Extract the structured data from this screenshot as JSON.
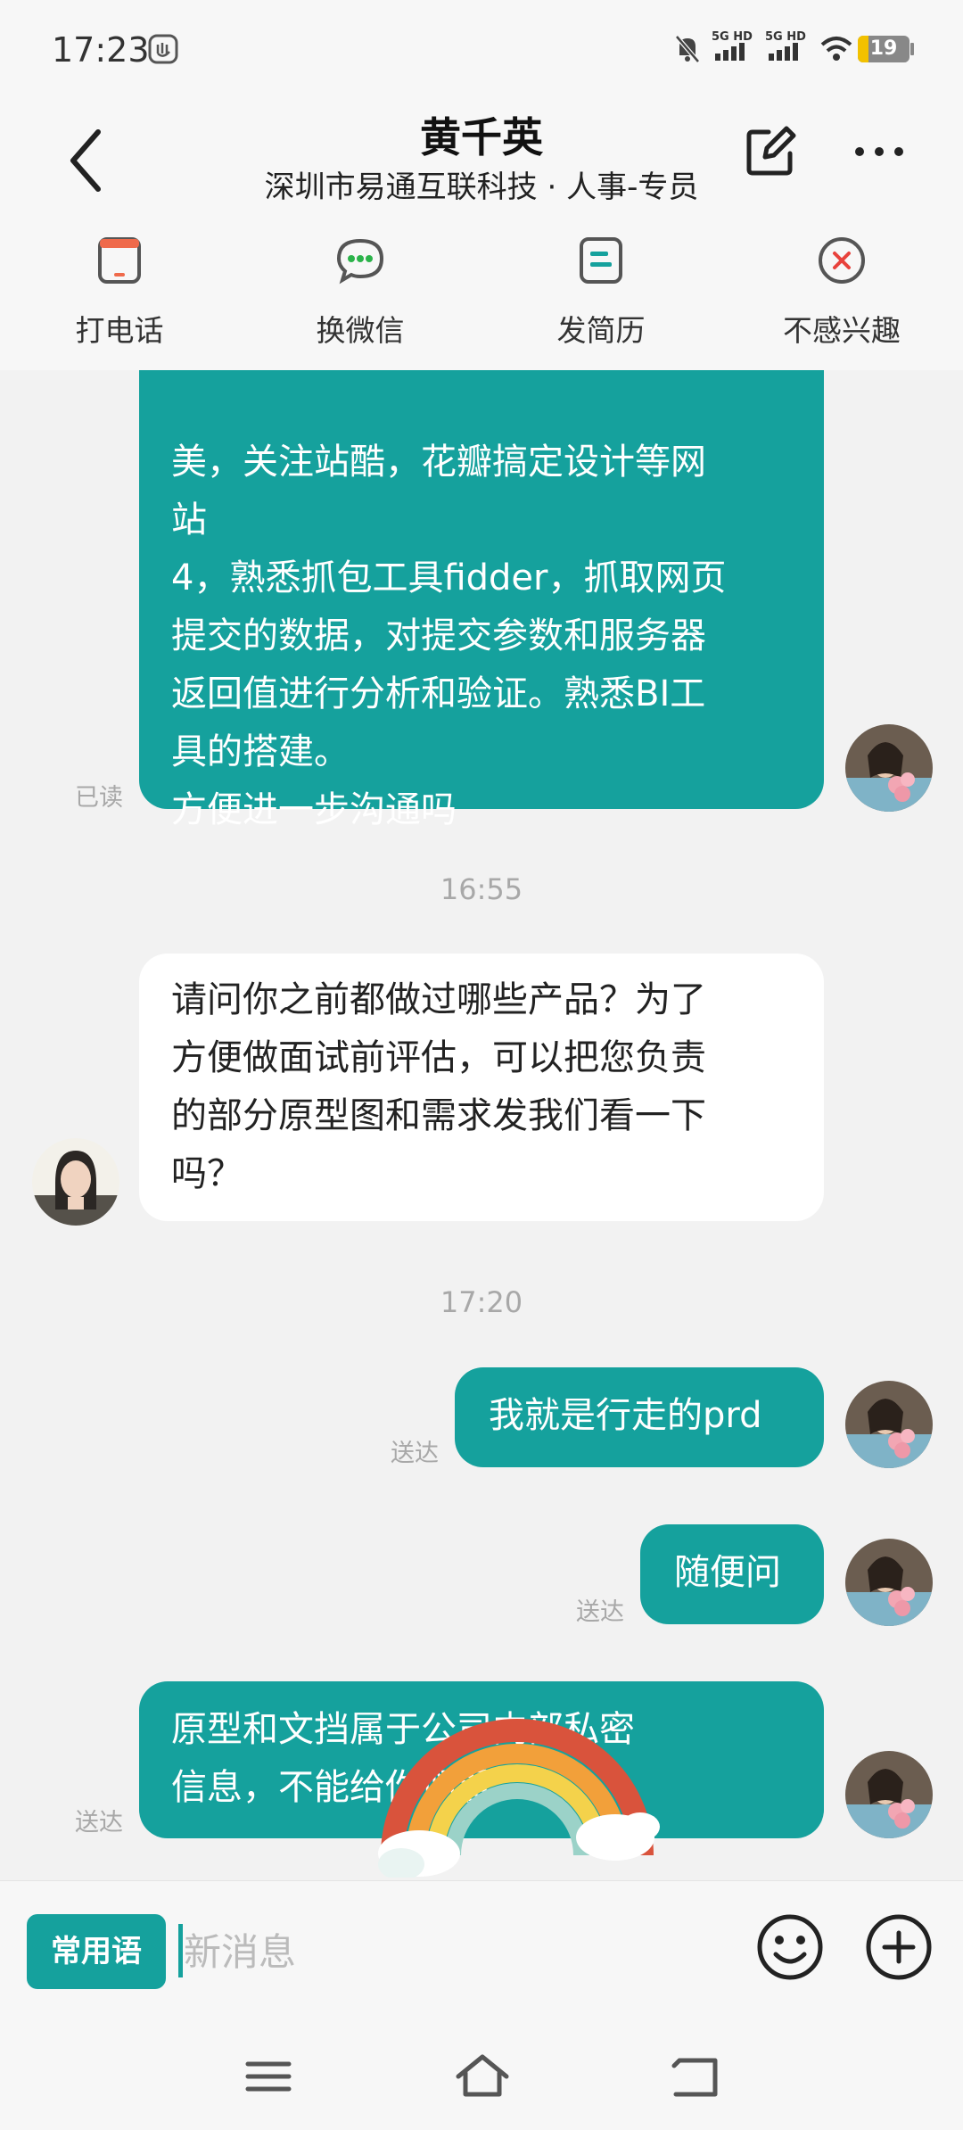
{
  "status_bar": {
    "time": "17:23",
    "network_1": "5G HD",
    "network_2": "5G HD",
    "battery": "19"
  },
  "header": {
    "name": "黄千英",
    "subtitle": "深圳市易通互联科技 · 人事-专员"
  },
  "actions": [
    {
      "label": "打电话",
      "icon": "phone-icon"
    },
    {
      "label": "换微信",
      "icon": "wechat-icon"
    },
    {
      "label": "发简历",
      "icon": "resume-icon"
    },
    {
      "label": "不感兴趣",
      "icon": "not-interested-icon"
    }
  ],
  "messages": {
    "m1": {
      "lines": [
        "美，关注站酷，花瓣搞定设计等网",
        "站",
        "4，熟悉抓包工具fidder，抓取网页",
        "提交的数据，对提交参数和服务器",
        "返回值进行分析和验证。熟悉BI工",
        "具的搭建。",
        "方便进一步沟通吗"
      ],
      "status": "已读"
    },
    "t1": "16:55",
    "m2": {
      "lines": [
        "请问你之前都做过哪些产品？为了",
        "方便做面试前评估，可以把您负责",
        "的部分原型图和需求发我们看一下",
        "吗？"
      ]
    },
    "t2": "17:20",
    "m3": {
      "text": "我就是行走的prd",
      "status": "送达"
    },
    "m4": {
      "text": "随便问",
      "status": "送达"
    },
    "m5": {
      "lines": [
        "原型和文挡属于公司内部私密",
        "信息，不能给你们看"
      ],
      "status": "送达"
    }
  },
  "input": {
    "phrases_label": "常用语",
    "placeholder": "新消息"
  },
  "colors": {
    "accent": "#15a19d",
    "incoming_bubble": "#ffffff",
    "background": "#f2f2f2"
  }
}
